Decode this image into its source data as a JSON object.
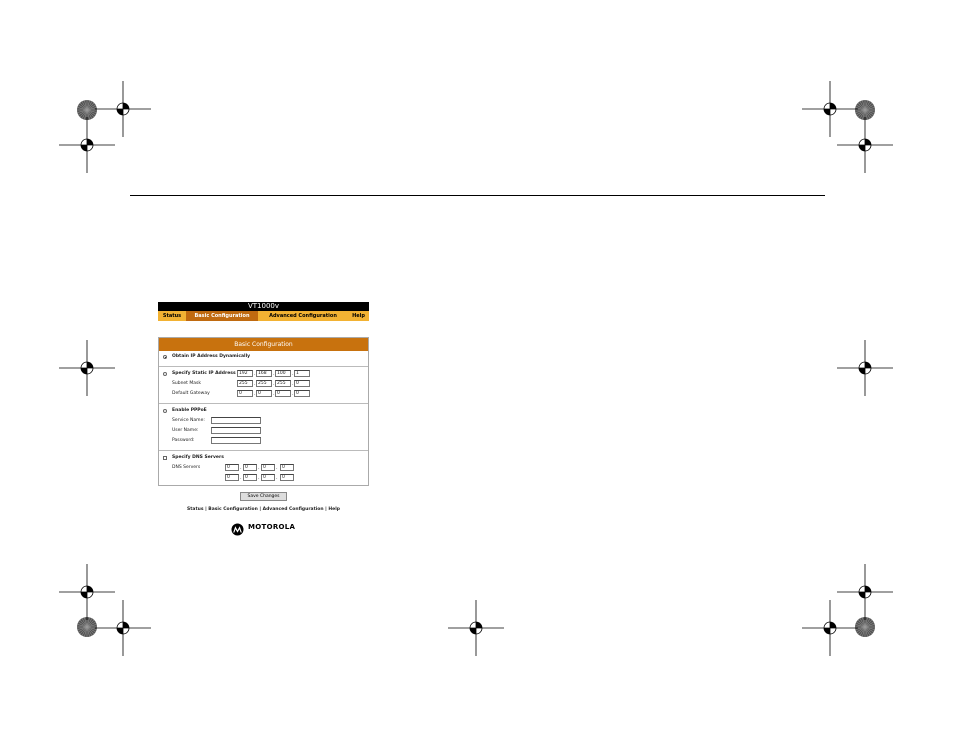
{
  "app": {
    "title": "VT1000v"
  },
  "nav": {
    "items": [
      {
        "label": "Status"
      },
      {
        "label": "Basic Configuration"
      },
      {
        "label": "Advanced Configuration"
      },
      {
        "label": "Help"
      }
    ],
    "active": "Basic Configuration"
  },
  "panel": {
    "title": "Basic Configuration",
    "dynamic": {
      "label": "Obtain IP Address Dynamically",
      "selected": true
    },
    "static": {
      "label": "Specify Static IP Address",
      "selected": false,
      "ip": [
        "192",
        "168",
        "100",
        "1"
      ],
      "subnet_label": "Subnet Mask",
      "subnet": [
        "255",
        "255",
        "255",
        "0"
      ],
      "gateway_label": "Default Gateway",
      "gateway": [
        "0",
        "0",
        "0",
        "0"
      ]
    },
    "pppoe": {
      "label": "Enable PPPoE",
      "selected": false,
      "service_label": "Service Name:",
      "user_label": "User Name:",
      "password_label": "Password:",
      "service": "",
      "user": "",
      "password": ""
    },
    "dns": {
      "label": "Specify DNS Servers",
      "checked": false,
      "servers_label": "DNS Servers",
      "primary": [
        "0",
        "0",
        "0",
        "0"
      ],
      "secondary": [
        "0",
        "0",
        "0",
        "0"
      ]
    }
  },
  "actions": {
    "save_label": "Save Changes"
  },
  "footer": {
    "links": [
      "Status",
      "Basic Configuration",
      "Advanced Configuration",
      "Help"
    ],
    "separator": " | ",
    "brand": "MOTOROLA"
  },
  "colors": {
    "nav_bg": "#f2b233",
    "nav_active": "#c06a10",
    "panel_header": "#c8720e",
    "title_bar": "#000000"
  }
}
